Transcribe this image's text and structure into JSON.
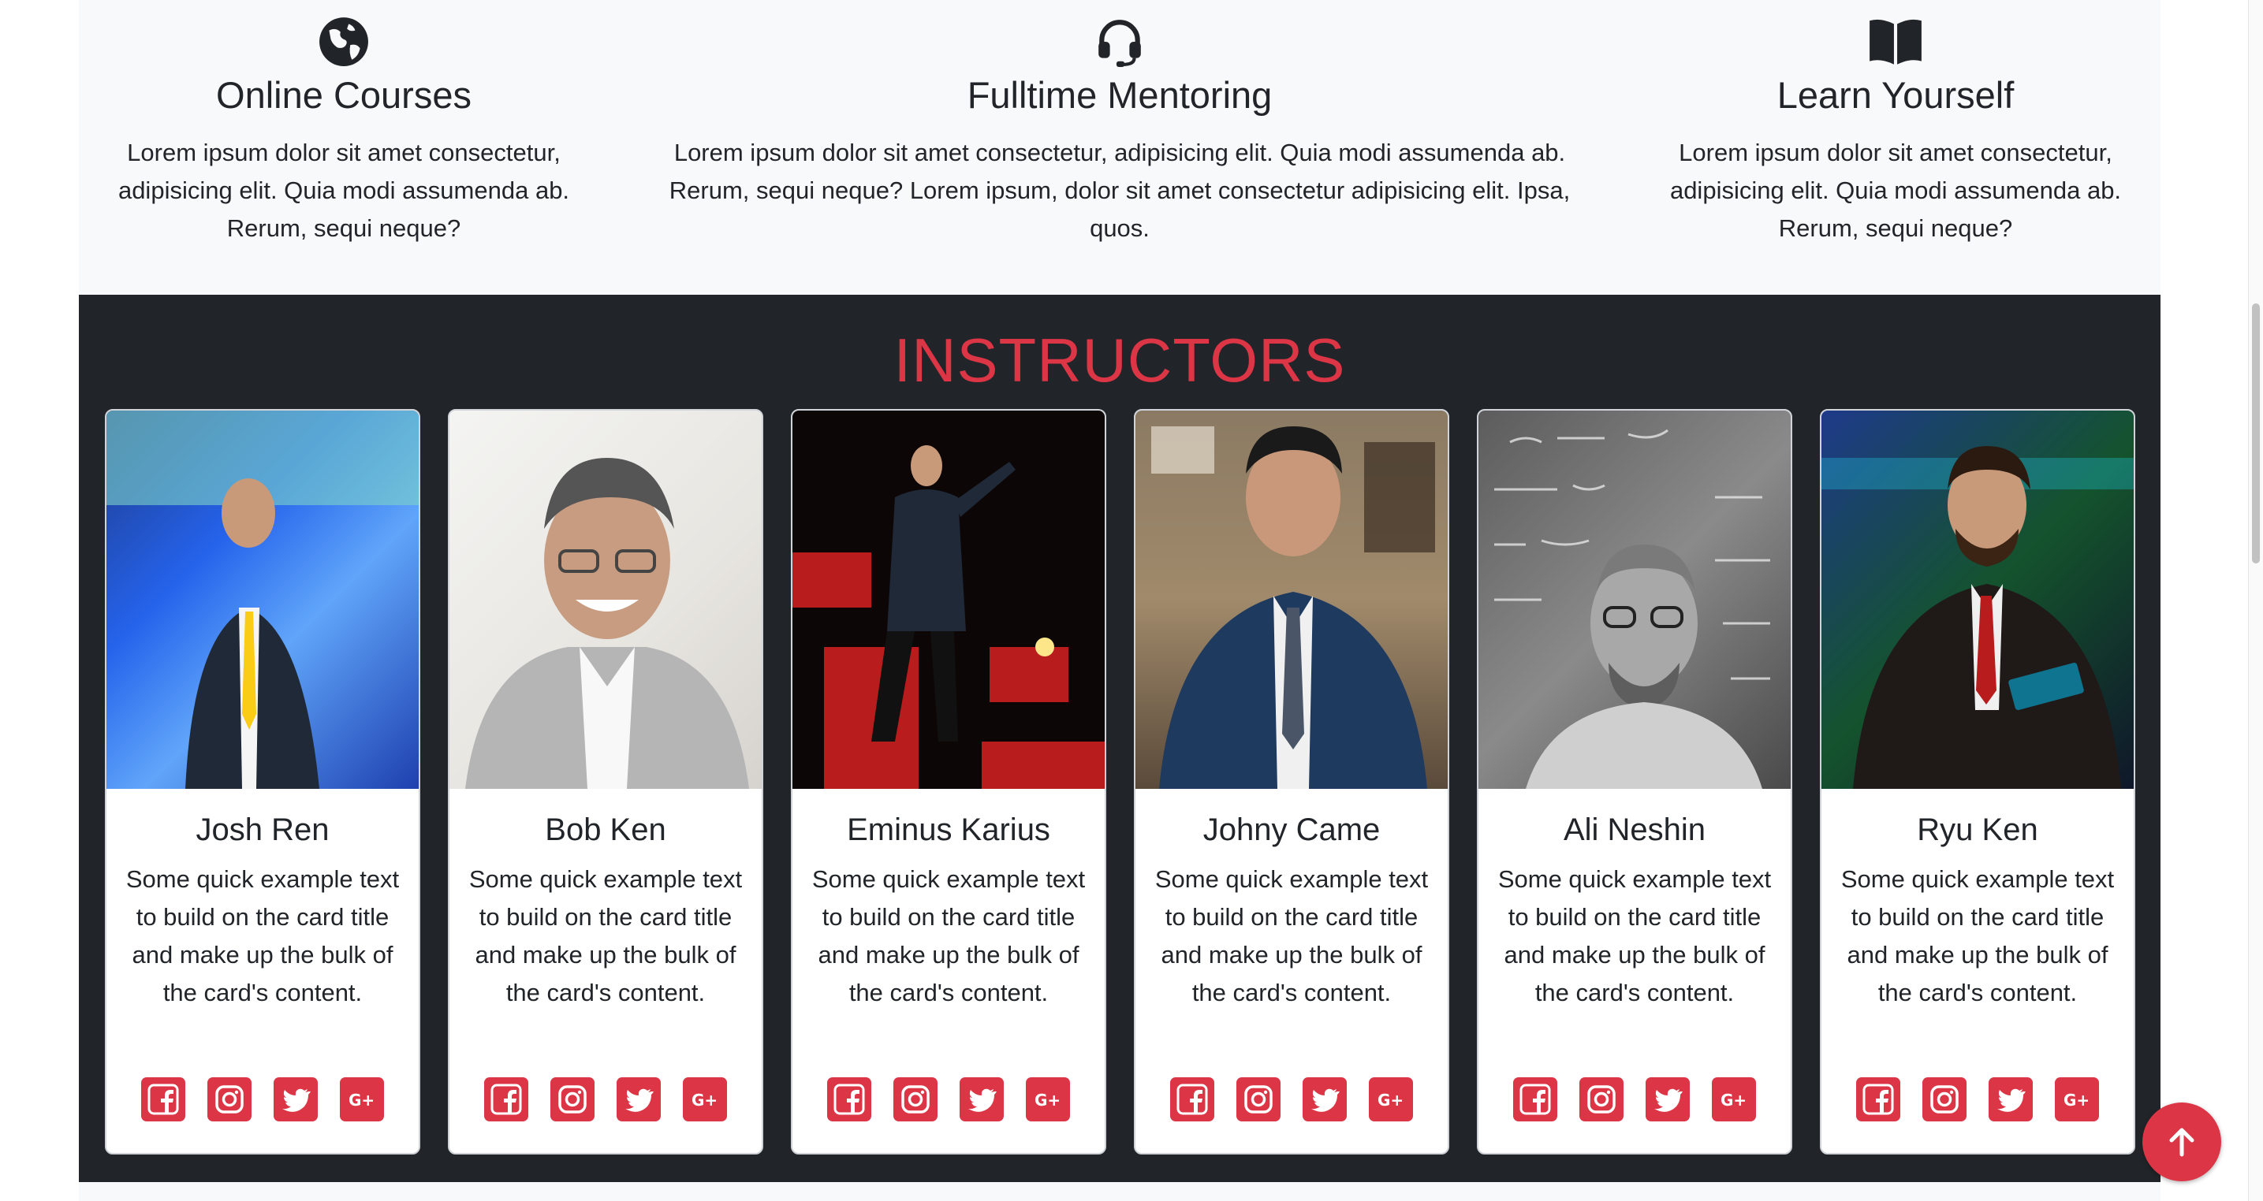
{
  "features": [
    {
      "icon": "globe-icon",
      "title": "Online Courses",
      "desc": "Lorem ipsum dolor sit amet consectetur, adipisicing elit. Quia modi assumenda ab. Rerum, sequi neque?"
    },
    {
      "icon": "headset-icon",
      "title": "Fulltime Mentoring",
      "desc": "Lorem ipsum dolor sit amet consectetur, adipisicing elit. Quia modi assumenda ab. Rerum, sequi neque? Lorem ipsum, dolor sit amet consectetur adipisicing elit. Ipsa, quos."
    },
    {
      "icon": "book-icon",
      "title": "Learn Yourself",
      "desc": "Lorem ipsum dolor sit amet consectetur, adipisicing elit. Quia modi assumenda ab. Rerum, sequi neque?"
    }
  ],
  "instructors": {
    "heading": "INSTRUCTORS",
    "cards": [
      {
        "name": "Josh Ren",
        "text": "Some quick example text to build on the card title and make up the bulk of the card's content."
      },
      {
        "name": "Bob Ken",
        "text": "Some quick example text to build on the card title and make up the bulk of the card's content."
      },
      {
        "name": "Eminus Karius",
        "text": "Some quick example text to build on the card title and make up the bulk of the card's content."
      },
      {
        "name": "Johny Came",
        "text": "Some quick example text to build on the card title and make up the bulk of the card's content."
      },
      {
        "name": "Ali Neshin",
        "text": "Some quick example text to build on the card title and make up the bulk of the card's content."
      },
      {
        "name": "Ryu Ken",
        "text": "Some quick example text to build on the card title and make up the bulk of the card's content."
      }
    ],
    "social_icons": [
      "facebook-icon",
      "instagram-icon",
      "twitter-icon",
      "google-plus-icon"
    ]
  },
  "colors": {
    "accent": "#dc3545",
    "dark_bg": "#212529",
    "light_bg": "#f8f9fa"
  }
}
